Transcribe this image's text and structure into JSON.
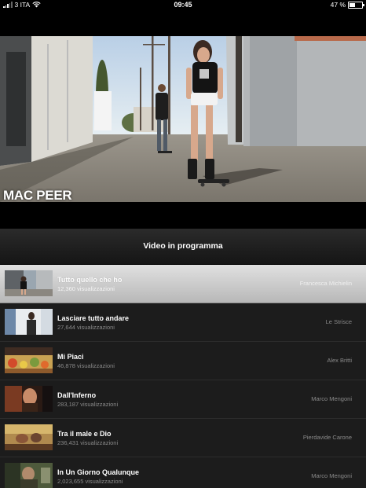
{
  "status_bar": {
    "carrier": "3 ITA",
    "time": "09:45",
    "battery": "47 %",
    "battery_level": 0.47,
    "wifi_icon": "wifi-icon",
    "signal_icon": "signal-bars-icon"
  },
  "player": {
    "artist_overlay": "MAC PEER"
  },
  "playlist": {
    "header": "Video in programma",
    "items": [
      {
        "title": "Tutto quello che ho",
        "views": "12,360 visualizzazioni",
        "artist": "Francesca Michielin",
        "selected": true
      },
      {
        "title": "Lasciare tutto andare",
        "views": "27,644 visualizzazioni",
        "artist": "Le Strisce",
        "selected": false
      },
      {
        "title": "Mi Piaci",
        "views": "46,878 visualizzazioni",
        "artist": "Alex Britti",
        "selected": false
      },
      {
        "title": "Dall'Inferno",
        "views": "283,187 visualizzazioni",
        "artist": "Marco Mengoni",
        "selected": false
      },
      {
        "title": "Tra il male e Dio",
        "views": "236,431 visualizzazioni",
        "artist": "Pierdavide Carone",
        "selected": false
      },
      {
        "title": "In Un Giorno Qualunque",
        "views": "2,023,655 visualizzazioni",
        "artist": "Marco Mengoni",
        "selected": false
      }
    ]
  },
  "colors": {
    "background": "#000000",
    "list_background": "#1c1c1c",
    "selected_row": "#cfcfcf"
  }
}
